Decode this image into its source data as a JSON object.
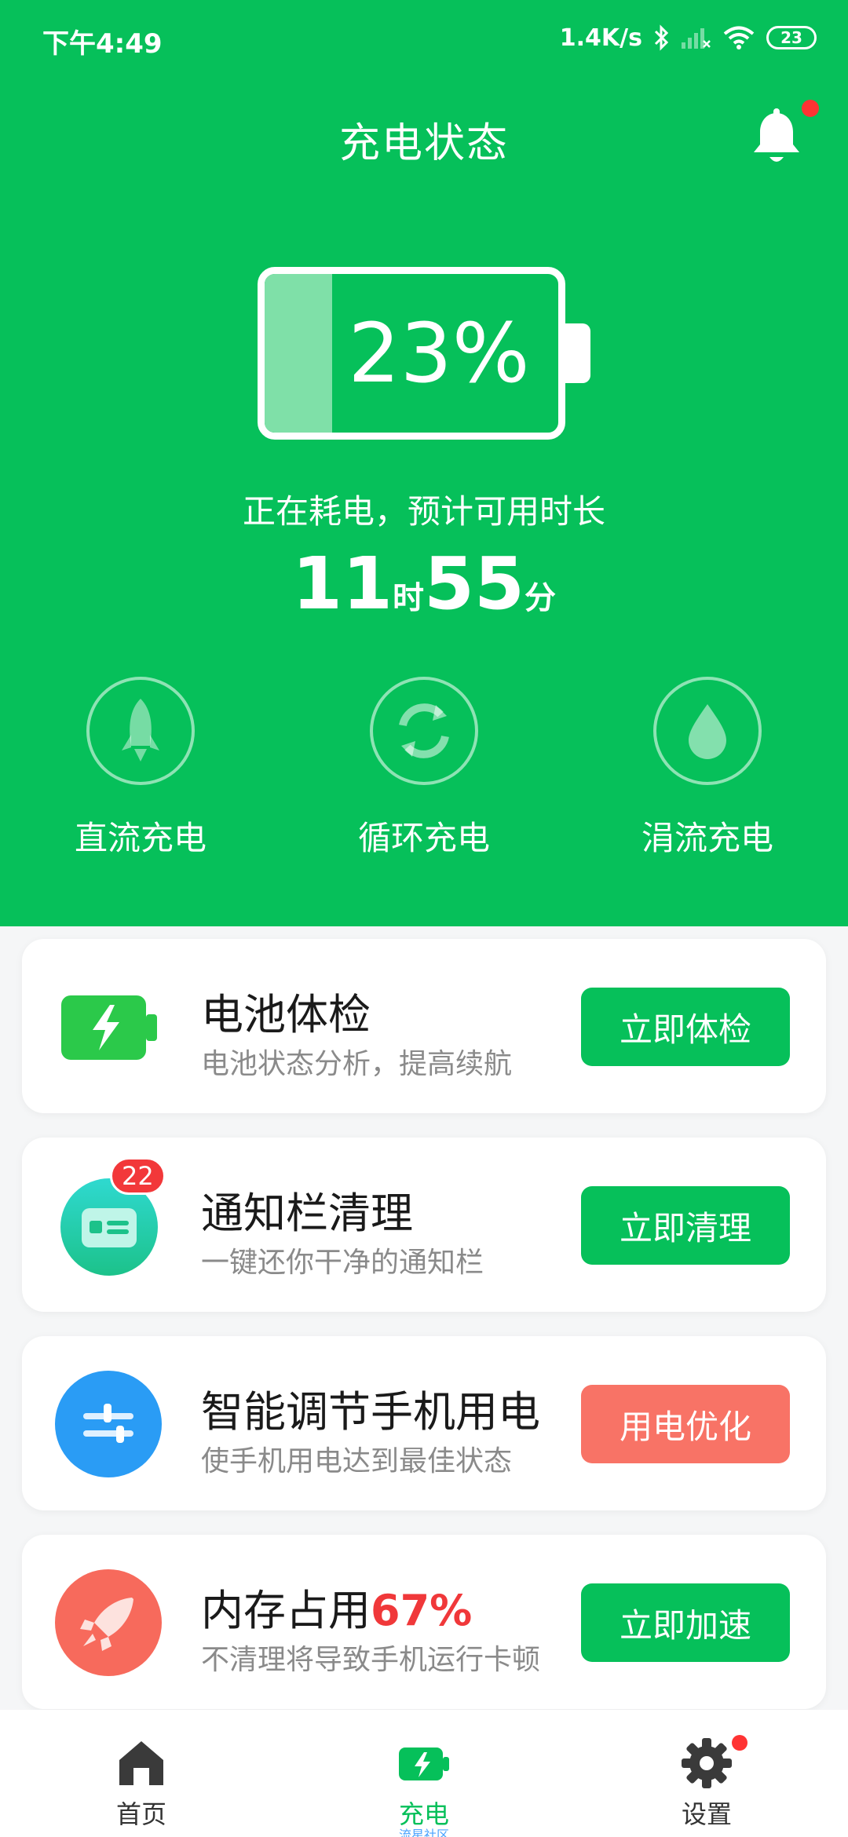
{
  "status_bar": {
    "time": "下午4:49",
    "net_speed": "1.4K/s",
    "battery_level": "23"
  },
  "header": {
    "title": "充电状态"
  },
  "battery": {
    "percent_text": "23%",
    "level_fraction": 0.23,
    "usage_text": "正在耗电，预计可用时长",
    "hours": "11",
    "hours_unit": "时",
    "minutes": "55",
    "minutes_unit": "分"
  },
  "modes": [
    {
      "label": "直流充电",
      "icon": "rocket-icon"
    },
    {
      "label": "循环充电",
      "icon": "cycle-icon"
    },
    {
      "label": "涓流充电",
      "icon": "drop-icon"
    }
  ],
  "cards": [
    {
      "title": "电池体检",
      "subtitle": "电池状态分析，提高续航",
      "button": "立即体检",
      "icon": "battery-bolt-icon"
    },
    {
      "title": "通知栏清理",
      "subtitle": "一键还你干净的通知栏",
      "button": "立即清理",
      "icon": "notification-card-icon",
      "badge": "22"
    },
    {
      "title": "智能调节手机用电",
      "subtitle": "使手机用电达到最佳状态",
      "button": "用电优化",
      "icon": "sliders-icon"
    },
    {
      "title": "内存占用",
      "title_highlight": "67%",
      "subtitle": "不清理将导致手机运行卡顿",
      "button": "立即加速",
      "icon": "rocket-icon"
    }
  ],
  "bottom_nav": [
    {
      "label": "首页",
      "icon": "home-icon"
    },
    {
      "label": "充电",
      "sub": "流星社区",
      "icon": "charge-icon",
      "active": true
    },
    {
      "label": "设置",
      "icon": "gear-icon"
    }
  ],
  "colors": {
    "primary": "#06c05a",
    "warn": "#f87366",
    "badge": "#f2383a",
    "highlight": "#f0383a"
  }
}
